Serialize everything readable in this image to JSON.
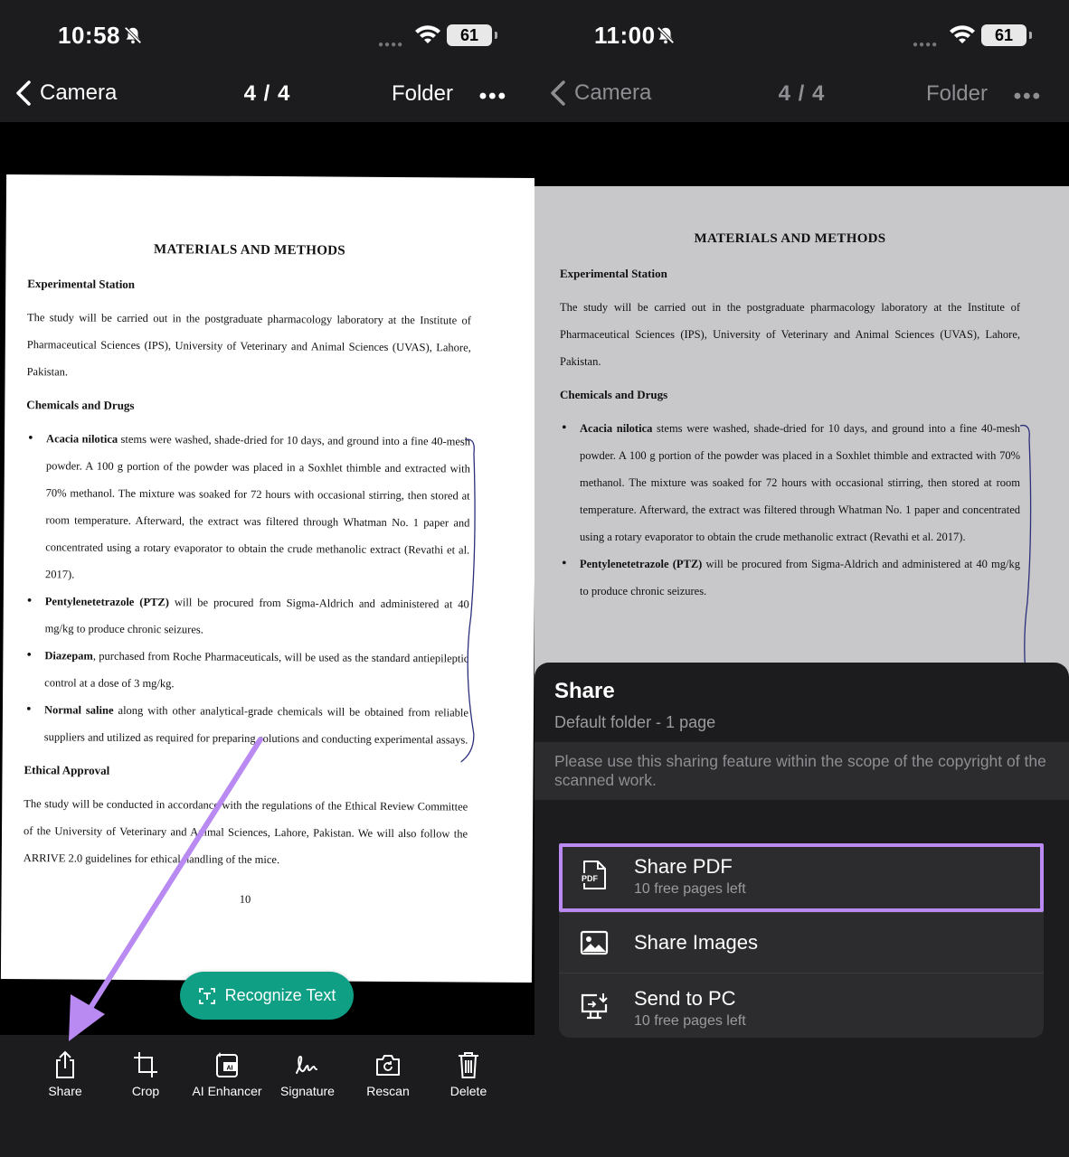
{
  "left": {
    "status": {
      "time": "10:58",
      "battery": "61"
    },
    "nav": {
      "back": "Camera",
      "page_count": "4 / 4",
      "folder": "Folder",
      "more": "•••"
    },
    "doc": {
      "title": "MATERIALS AND METHODS",
      "sec1_heading": "Experimental Station",
      "sec1_body": "The study will be carried out in the postgraduate pharmacology laboratory at the Institute of Pharmaceutical Sciences (IPS), University of Veterinary and Animal Sciences (UVAS), Lahore, Pakistan.",
      "sec2_heading": "Chemicals and Drugs",
      "bullets": [
        {
          "bold": "Acacia nilotica",
          "text": " stems were washed, shade-dried for 10 days, and ground into a fine 40-mesh powder. A 100 g portion of the powder was placed in a Soxhlet thimble and extracted with 70% methanol. The mixture was soaked for 72 hours with occasional stirring, then stored at room temperature. Afterward, the extract was filtered through Whatman No. 1 paper and concentrated using a rotary evaporator to obtain the crude methanolic extract (Revathi et al. 2017)."
        },
        {
          "bold": "Pentylenetetrazole (PTZ)",
          "text": " will be procured from Sigma-Aldrich and administered at 40 mg/kg to produce chronic seizures."
        },
        {
          "bold": "Diazepam",
          "text": ", purchased from Roche Pharmaceuticals, will be used as the standard antiepileptic control at a dose of 3 mg/kg."
        },
        {
          "bold": "Normal saline",
          "text": " along with other analytical-grade chemicals will be obtained from reliable suppliers and utilized as required for preparing solutions and conducting experimental assays."
        }
      ],
      "sec3_heading": "Ethical Approval",
      "sec3_body": "The study will be conducted in accordance with the regulations of the Ethical Review Committee of the University of Veterinary and Animal Sciences, Lahore, Pakistan. We will also follow the ARRIVE 2.0 guidelines for ethical handling of the mice.",
      "page_number": "10"
    },
    "recognize_label": "Recognize Text",
    "toolbar": [
      {
        "label": "Share",
        "icon": "share-icon"
      },
      {
        "label": "Crop",
        "icon": "crop-icon"
      },
      {
        "label": "AI Enhancer",
        "icon": "ai-enhancer-icon"
      },
      {
        "label": "Signature",
        "icon": "signature-icon"
      },
      {
        "label": "Rescan",
        "icon": "rescan-icon"
      },
      {
        "label": "Delete",
        "icon": "trash-icon"
      }
    ]
  },
  "right": {
    "status": {
      "time": "11:00",
      "battery": "61"
    },
    "nav": {
      "back": "Camera",
      "page_count": "4 / 4",
      "folder": "Folder",
      "more": "•••"
    },
    "sheet": {
      "title": "Share",
      "subtitle": "Default folder - 1 page",
      "notice": "Please use this sharing feature within the scope of the copyright of the scanned work.",
      "options": [
        {
          "label": "Share PDF",
          "sublabel": "10 free pages left",
          "icon": "pdf-icon"
        },
        {
          "label": "Share Images",
          "sublabel": "",
          "icon": "image-icon"
        },
        {
          "label": "Send to PC",
          "sublabel": "10 free pages left",
          "icon": "send-to-pc-icon"
        }
      ]
    }
  },
  "colors": {
    "accent_teal": "#0f9f85",
    "highlight_purple": "#b98af2",
    "sheet_bg": "#1c1c1e"
  }
}
